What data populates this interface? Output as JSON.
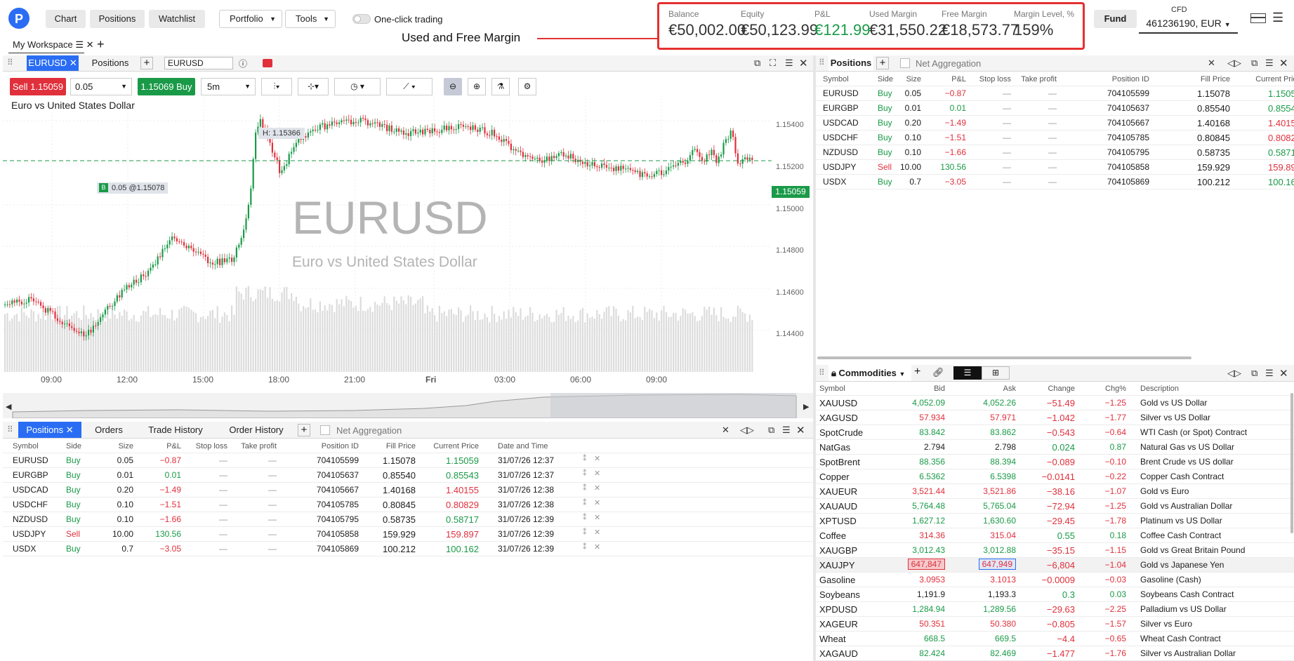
{
  "toolbar": {
    "chart": "Chart",
    "positions": "Positions",
    "watchlist": "Watchlist",
    "portfolio": "Portfolio",
    "tools": "Tools",
    "one_click": "One-click trading",
    "fund": "Fund",
    "account_type": "CFD",
    "account": "461236190, EUR"
  },
  "account": {
    "balance_label": "Balance",
    "balance": "€50,002.00",
    "equity_label": "Equity",
    "equity": "€50,123.99",
    "pnl_label": "P&L",
    "pnl": "€121.99",
    "used_margin_label": "Used Margin",
    "used_margin": "€31,550.22",
    "free_margin_label": "Free Margin",
    "free_margin": "€18,573.77",
    "margin_level_label": "Margin Level, %",
    "margin_level": "159%"
  },
  "annotation": "Used and Free Margin",
  "workspace": "My Workspace",
  "chart_panel": {
    "tab_eurusd": "EURUSD",
    "tab_positions": "Positions",
    "symbol_input": "EURUSD",
    "sell": "Sell 1.15059",
    "amount": "0.05",
    "buy": "1.15069 Buy",
    "timeframe": "5m",
    "title": "Euro vs United States Dollar",
    "watermark_symbol": "EURUSD",
    "watermark_desc": "Euro vs United States Dollar",
    "high_label": "H: 1.15366",
    "position_label": "0.05 @1.15078",
    "position_marker": "B",
    "current_price": "1.15059",
    "y_ticks": [
      "1.15400",
      "1.15200",
      "1.15000",
      "1.14800",
      "1.14600",
      "1.14400"
    ],
    "x_ticks": [
      "09:00",
      "12:00",
      "15:00",
      "18:00",
      "21:00",
      "Fri",
      "03:00",
      "06:00",
      "09:00"
    ]
  },
  "positions_columns": {
    "symbol": "Symbol",
    "side": "Side",
    "size": "Size",
    "pnl": "P&L",
    "sl": "Stop loss",
    "tp": "Take profit",
    "id": "Position ID",
    "fill": "Fill Price",
    "current": "Current Price",
    "date": "Date and Time"
  },
  "positions_panel": {
    "tab": "Positions",
    "net": "Net Aggregation"
  },
  "bottom_panel": {
    "tab_positions": "Positions",
    "tab_orders": "Orders",
    "tab_trade_history": "Trade History",
    "tab_order_history": "Order History",
    "net": "Net Aggregation"
  },
  "positions": [
    {
      "symbol": "EURUSD",
      "side": "Buy",
      "size": "0.05",
      "pnl": "−0.87",
      "sl": "—",
      "tp": "—",
      "id": "704105599",
      "fill": "1.15078",
      "current": "1.15059",
      "date": "31/07/26 12:37",
      "pnl_neg": true,
      "cur_neg": false
    },
    {
      "symbol": "EURGBP",
      "side": "Buy",
      "size": "0.01",
      "pnl": "0.01",
      "sl": "—",
      "tp": "—",
      "id": "704105637",
      "fill": "0.85540",
      "current": "0.85543",
      "date": "31/07/26 12:37",
      "pnl_neg": false,
      "cur_neg": false
    },
    {
      "symbol": "USDCAD",
      "side": "Buy",
      "size": "0.20",
      "pnl": "−1.49",
      "sl": "—",
      "tp": "—",
      "id": "704105667",
      "fill": "1.40168",
      "current": "1.40155",
      "date": "31/07/26 12:38",
      "pnl_neg": true,
      "cur_neg": true
    },
    {
      "symbol": "USDCHF",
      "side": "Buy",
      "size": "0.10",
      "pnl": "−1.51",
      "sl": "—",
      "tp": "—",
      "id": "704105785",
      "fill": "0.80845",
      "current": "0.80829",
      "date": "31/07/26 12:38",
      "pnl_neg": true,
      "cur_neg": true
    },
    {
      "symbol": "NZDUSD",
      "side": "Buy",
      "size": "0.10",
      "pnl": "−1.66",
      "sl": "—",
      "tp": "—",
      "id": "704105795",
      "fill": "0.58735",
      "current": "0.58717",
      "date": "31/07/26 12:39",
      "pnl_neg": true,
      "cur_neg": false
    },
    {
      "symbol": "USDJPY",
      "side": "Sell",
      "size": "10.00",
      "pnl": "130.56",
      "sl": "—",
      "tp": "—",
      "id": "704105858",
      "fill": "159.929",
      "current": "159.897",
      "date": "31/07/26 12:39",
      "pnl_neg": false,
      "cur_neg": true
    },
    {
      "symbol": "USDX",
      "side": "Buy",
      "size": "0.7",
      "pnl": "−3.05",
      "sl": "—",
      "tp": "—",
      "id": "704105869",
      "fill": "100.212",
      "current": "100.162",
      "date": "31/07/26 12:39",
      "pnl_neg": true,
      "cur_neg": false
    }
  ],
  "commodities_panel": {
    "title": "Commodities",
    "cols": {
      "symbol": "Symbol",
      "bid": "Bid",
      "ask": "Ask",
      "change": "Change",
      "chgp": "Chg%",
      "desc": "Description"
    }
  },
  "commodities": [
    {
      "symbol": "XAUUSD",
      "bid": "4,052.09",
      "ask": "4,052.26",
      "change": "−51.49",
      "chgp": "−1.25",
      "desc": "Gold vs US Dollar",
      "c": "g"
    },
    {
      "symbol": "XAGUSD",
      "bid": "57.934",
      "ask": "57.971",
      "change": "−1.042",
      "chgp": "−1.77",
      "desc": "Silver vs US Dollar",
      "c": "r"
    },
    {
      "symbol": "SpotCrude",
      "bid": "83.842",
      "ask": "83.862",
      "change": "−0.543",
      "chgp": "−0.64",
      "desc": "WTI Cash (or Spot) Contract",
      "c": "g"
    },
    {
      "symbol": "NatGas",
      "bid": "2.794",
      "ask": "2.798",
      "change": "0.024",
      "chgp": "0.87",
      "desc": "Natural Gas vs US Dollar",
      "c": "k"
    },
    {
      "symbol": "SpotBrent",
      "bid": "88.356",
      "ask": "88.394",
      "change": "−0.089",
      "chgp": "−0.10",
      "desc": "Brent Crude vs US dollar",
      "c": "g"
    },
    {
      "symbol": "Copper",
      "bid": "6.5362",
      "ask": "6.5398",
      "change": "−0.0141",
      "chgp": "−0.22",
      "desc": "Copper Cash Contract",
      "c": "g"
    },
    {
      "symbol": "XAUEUR",
      "bid": "3,521.44",
      "ask": "3,521.86",
      "change": "−38.16",
      "chgp": "−1.07",
      "desc": "Gold vs Euro",
      "c": "r"
    },
    {
      "symbol": "XAUAUD",
      "bid": "5,764.48",
      "ask": "5,765.04",
      "change": "−72.94",
      "chgp": "−1.25",
      "desc": "Gold vs Australian Dollar",
      "c": "g"
    },
    {
      "symbol": "XPTUSD",
      "bid": "1,627.12",
      "ask": "1,630.60",
      "change": "−29.45",
      "chgp": "−1.78",
      "desc": "Platinum vs US Dollar",
      "c": "g"
    },
    {
      "symbol": "Coffee",
      "bid": "314.36",
      "ask": "315.04",
      "change": "0.55",
      "chgp": "0.18",
      "desc": "Coffee Cash Contract",
      "c": "r"
    },
    {
      "symbol": "XAUGBP",
      "bid": "3,012.43",
      "ask": "3,012.88",
      "change": "−35.15",
      "chgp": "−1.15",
      "desc": "Gold vs Great Britain Pound",
      "c": "g"
    },
    {
      "symbol": "XAUJPY",
      "bid": "647,847",
      "ask": "647,949",
      "change": "−6,804",
      "chgp": "−1.04",
      "desc": "Gold vs Japanese Yen",
      "c": "box"
    },
    {
      "symbol": "Gasoline",
      "bid": "3.0953",
      "ask": "3.1013",
      "change": "−0.0009",
      "chgp": "−0.03",
      "desc": "Gasoline (Cash)",
      "c": "r"
    },
    {
      "symbol": "Soybeans",
      "bid": "1,191.9",
      "ask": "1,193.3",
      "change": "0.3",
      "chgp": "0.03",
      "desc": "Soybeans Cash Contract",
      "c": "k"
    },
    {
      "symbol": "XPDUSD",
      "bid": "1,284.94",
      "ask": "1,289.56",
      "change": "−29.63",
      "chgp": "−2.25",
      "desc": "Palladium vs US Dollar",
      "c": "g"
    },
    {
      "symbol": "XAGEUR",
      "bid": "50.351",
      "ask": "50.380",
      "change": "−0.805",
      "chgp": "−1.57",
      "desc": "Silver vs Euro",
      "c": "r"
    },
    {
      "symbol": "Wheat",
      "bid": "668.5",
      "ask": "669.5",
      "change": "−4.4",
      "chgp": "−0.65",
      "desc": "Wheat Cash Contract",
      "c": "g"
    },
    {
      "symbol": "XAGAUD",
      "bid": "82.424",
      "ask": "82.469",
      "change": "−1.477",
      "chgp": "−1.76",
      "desc": "Silver vs Australian Dollar",
      "c": "g"
    }
  ],
  "colors": {
    "buy": "#1a9a48",
    "sell": "#e0303c",
    "accent": "#2a6df4",
    "highlight": "#e53030"
  }
}
